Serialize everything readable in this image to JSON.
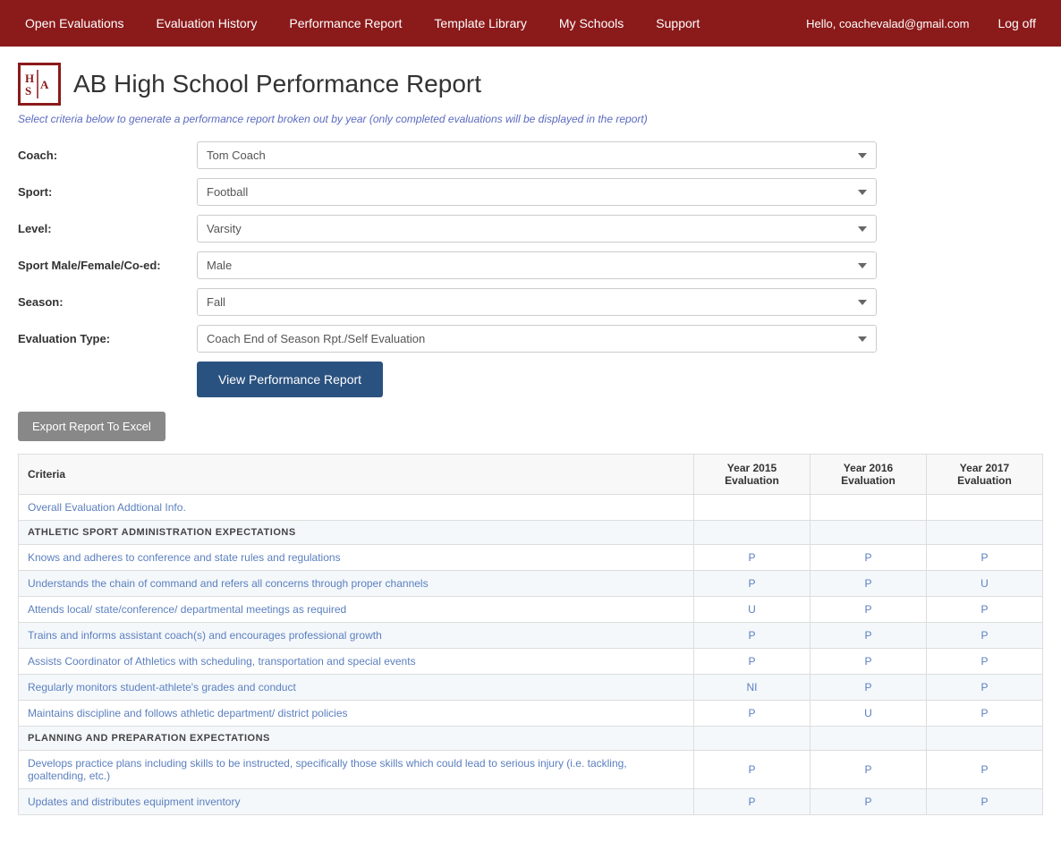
{
  "nav": {
    "items": [
      {
        "label": "Open Evaluations",
        "id": "open-evaluations"
      },
      {
        "label": "Evaluation History",
        "id": "evaluation-history"
      },
      {
        "label": "Performance Report",
        "id": "performance-report"
      },
      {
        "label": "Template Library",
        "id": "template-library"
      },
      {
        "label": "My Schools",
        "id": "my-schools"
      },
      {
        "label": "Support",
        "id": "support"
      }
    ],
    "user_greeting": "Hello, coachevalad@gmail.com",
    "logoff_label": "Log off"
  },
  "page": {
    "title": "AB High School Performance Report",
    "subtitle": "Select criteria below to generate a performance report broken out by year (only completed evaluations will be displayed in the report)"
  },
  "form": {
    "coach_label": "Coach:",
    "coach_value": "Tom Coach",
    "sport_label": "Sport:",
    "sport_value": "Football",
    "level_label": "Level:",
    "level_value": "Varsity",
    "gender_label": "Sport Male/Female/Co-ed:",
    "gender_value": "Male",
    "season_label": "Season:",
    "season_value": "Fall",
    "eval_type_label": "Evaluation Type:",
    "eval_type_value": "Coach End of Season Rpt./Self Evaluation",
    "view_button_label": "View Performance Report",
    "export_button_label": "Export Report To Excel"
  },
  "table": {
    "columns": [
      "Criteria",
      "Year 2015 Evaluation",
      "Year 2016 Evaluation",
      "Year 2017 Evaluation"
    ],
    "rows": [
      {
        "type": "data",
        "criteria": "Overall Evaluation Addtional Info.",
        "y2015": "",
        "y2016": "",
        "y2017": ""
      },
      {
        "type": "header",
        "criteria": "ATHLETIC SPORT ADMINISTRATION EXPECTATIONS",
        "y2015": "",
        "y2016": "",
        "y2017": ""
      },
      {
        "type": "data",
        "criteria": "Knows and adheres to conference and state rules and regulations",
        "y2015": "P",
        "y2016": "P",
        "y2017": "P"
      },
      {
        "type": "data",
        "criteria": "Understands the chain of command and refers all concerns through proper channels",
        "y2015": "P",
        "y2016": "P",
        "y2017": "U"
      },
      {
        "type": "data",
        "criteria": "Attends local/ state/conference/ departmental meetings as required",
        "y2015": "U",
        "y2016": "P",
        "y2017": "P"
      },
      {
        "type": "data",
        "criteria": "Trains and informs assistant coach(s) and encourages professional growth",
        "y2015": "P",
        "y2016": "P",
        "y2017": "P"
      },
      {
        "type": "data",
        "criteria": "Assists Coordinator of Athletics with scheduling, transportation and special events",
        "y2015": "P",
        "y2016": "P",
        "y2017": "P"
      },
      {
        "type": "data",
        "criteria": "Regularly monitors student-athlete's grades and conduct",
        "y2015": "NI",
        "y2016": "P",
        "y2017": "P"
      },
      {
        "type": "data",
        "criteria": "Maintains discipline and follows athletic department/ district policies",
        "y2015": "P",
        "y2016": "U",
        "y2017": "P"
      },
      {
        "type": "header",
        "criteria": "PLANNING AND PREPARATION EXPECTATIONS",
        "y2015": "",
        "y2016": "",
        "y2017": ""
      },
      {
        "type": "data",
        "criteria": "Develops practice plans including skills to be instructed, specifically those skills which could lead to serious injury (i.e. tackling, goaltending, etc.)",
        "y2015": "P",
        "y2016": "P",
        "y2017": "P"
      },
      {
        "type": "data",
        "criteria": "Updates and distributes equipment inventory",
        "y2015": "P",
        "y2016": "P",
        "y2017": "P"
      }
    ]
  }
}
